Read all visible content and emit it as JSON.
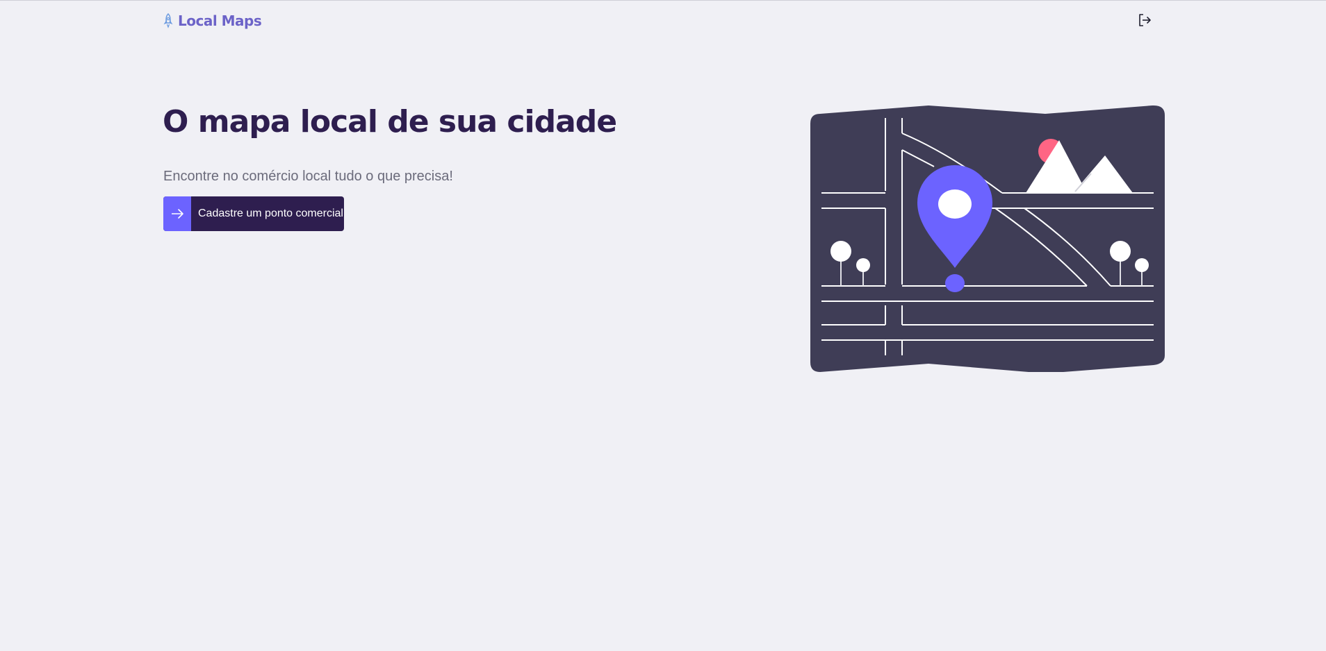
{
  "app": {
    "name": "Local Maps"
  },
  "header": {
    "logo_icon": "rocket-icon",
    "logout_icon": "logout-icon"
  },
  "hero": {
    "title": "O mapa local de sua cidade",
    "subtitle": "Encontre no comércio local tudo o que precisa!",
    "cta_label": "Cadastre um ponto comercial",
    "cta_icon": "arrow-right-icon"
  },
  "illustration": {
    "name": "city-map-illustration"
  },
  "colors": {
    "background": "#f0f0f5",
    "primary": "#6c63ff",
    "title": "#2e1e4f",
    "logo": "#6c63c8",
    "text_muted": "#6b6b7b",
    "map_base": "#3f3d56",
    "sun": "#ff6584"
  }
}
